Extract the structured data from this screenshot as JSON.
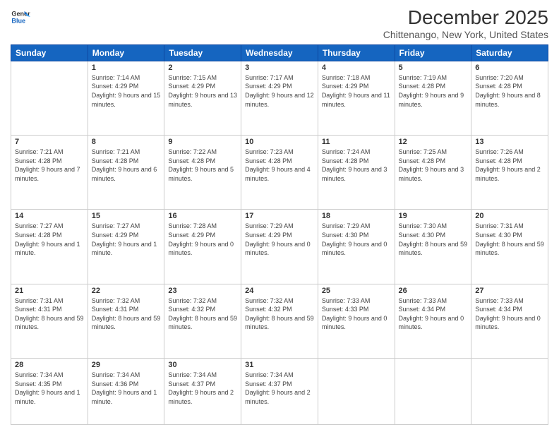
{
  "logo": {
    "line1": "General",
    "line2": "Blue"
  },
  "header": {
    "title": "December 2025",
    "subtitle": "Chittenango, New York, United States"
  },
  "weekdays": [
    "Sunday",
    "Monday",
    "Tuesday",
    "Wednesday",
    "Thursday",
    "Friday",
    "Saturday"
  ],
  "weeks": [
    [
      {
        "day": "",
        "empty": true
      },
      {
        "day": "1",
        "sunrise": "7:14 AM",
        "sunset": "4:29 PM",
        "daylight": "9 hours and 15 minutes."
      },
      {
        "day": "2",
        "sunrise": "7:15 AM",
        "sunset": "4:29 PM",
        "daylight": "9 hours and 13 minutes."
      },
      {
        "day": "3",
        "sunrise": "7:17 AM",
        "sunset": "4:29 PM",
        "daylight": "9 hours and 12 minutes."
      },
      {
        "day": "4",
        "sunrise": "7:18 AM",
        "sunset": "4:29 PM",
        "daylight": "9 hours and 11 minutes."
      },
      {
        "day": "5",
        "sunrise": "7:19 AM",
        "sunset": "4:28 PM",
        "daylight": "9 hours and 9 minutes."
      },
      {
        "day": "6",
        "sunrise": "7:20 AM",
        "sunset": "4:28 PM",
        "daylight": "9 hours and 8 minutes."
      }
    ],
    [
      {
        "day": "7",
        "sunrise": "7:21 AM",
        "sunset": "4:28 PM",
        "daylight": "9 hours and 7 minutes."
      },
      {
        "day": "8",
        "sunrise": "7:21 AM",
        "sunset": "4:28 PM",
        "daylight": "9 hours and 6 minutes."
      },
      {
        "day": "9",
        "sunrise": "7:22 AM",
        "sunset": "4:28 PM",
        "daylight": "9 hours and 5 minutes."
      },
      {
        "day": "10",
        "sunrise": "7:23 AM",
        "sunset": "4:28 PM",
        "daylight": "9 hours and 4 minutes."
      },
      {
        "day": "11",
        "sunrise": "7:24 AM",
        "sunset": "4:28 PM",
        "daylight": "9 hours and 3 minutes."
      },
      {
        "day": "12",
        "sunrise": "7:25 AM",
        "sunset": "4:28 PM",
        "daylight": "9 hours and 3 minutes."
      },
      {
        "day": "13",
        "sunrise": "7:26 AM",
        "sunset": "4:28 PM",
        "daylight": "9 hours and 2 minutes."
      }
    ],
    [
      {
        "day": "14",
        "sunrise": "7:27 AM",
        "sunset": "4:28 PM",
        "daylight": "9 hours and 1 minute."
      },
      {
        "day": "15",
        "sunrise": "7:27 AM",
        "sunset": "4:29 PM",
        "daylight": "9 hours and 1 minute."
      },
      {
        "day": "16",
        "sunrise": "7:28 AM",
        "sunset": "4:29 PM",
        "daylight": "9 hours and 0 minutes."
      },
      {
        "day": "17",
        "sunrise": "7:29 AM",
        "sunset": "4:29 PM",
        "daylight": "9 hours and 0 minutes."
      },
      {
        "day": "18",
        "sunrise": "7:29 AM",
        "sunset": "4:30 PM",
        "daylight": "9 hours and 0 minutes."
      },
      {
        "day": "19",
        "sunrise": "7:30 AM",
        "sunset": "4:30 PM",
        "daylight": "8 hours and 59 minutes."
      },
      {
        "day": "20",
        "sunrise": "7:31 AM",
        "sunset": "4:30 PM",
        "daylight": "8 hours and 59 minutes."
      }
    ],
    [
      {
        "day": "21",
        "sunrise": "7:31 AM",
        "sunset": "4:31 PM",
        "daylight": "8 hours and 59 minutes."
      },
      {
        "day": "22",
        "sunrise": "7:32 AM",
        "sunset": "4:31 PM",
        "daylight": "8 hours and 59 minutes."
      },
      {
        "day": "23",
        "sunrise": "7:32 AM",
        "sunset": "4:32 PM",
        "daylight": "8 hours and 59 minutes."
      },
      {
        "day": "24",
        "sunrise": "7:32 AM",
        "sunset": "4:32 PM",
        "daylight": "8 hours and 59 minutes."
      },
      {
        "day": "25",
        "sunrise": "7:33 AM",
        "sunset": "4:33 PM",
        "daylight": "9 hours and 0 minutes."
      },
      {
        "day": "26",
        "sunrise": "7:33 AM",
        "sunset": "4:34 PM",
        "daylight": "9 hours and 0 minutes."
      },
      {
        "day": "27",
        "sunrise": "7:33 AM",
        "sunset": "4:34 PM",
        "daylight": "9 hours and 0 minutes."
      }
    ],
    [
      {
        "day": "28",
        "sunrise": "7:34 AM",
        "sunset": "4:35 PM",
        "daylight": "9 hours and 1 minute."
      },
      {
        "day": "29",
        "sunrise": "7:34 AM",
        "sunset": "4:36 PM",
        "daylight": "9 hours and 1 minute."
      },
      {
        "day": "30",
        "sunrise": "7:34 AM",
        "sunset": "4:37 PM",
        "daylight": "9 hours and 2 minutes."
      },
      {
        "day": "31",
        "sunrise": "7:34 AM",
        "sunset": "4:37 PM",
        "daylight": "9 hours and 2 minutes."
      },
      {
        "day": "",
        "empty": true
      },
      {
        "day": "",
        "empty": true
      },
      {
        "day": "",
        "empty": true
      }
    ]
  ],
  "labels": {
    "sunrise": "Sunrise:",
    "sunset": "Sunset:",
    "daylight": "Daylight:"
  }
}
